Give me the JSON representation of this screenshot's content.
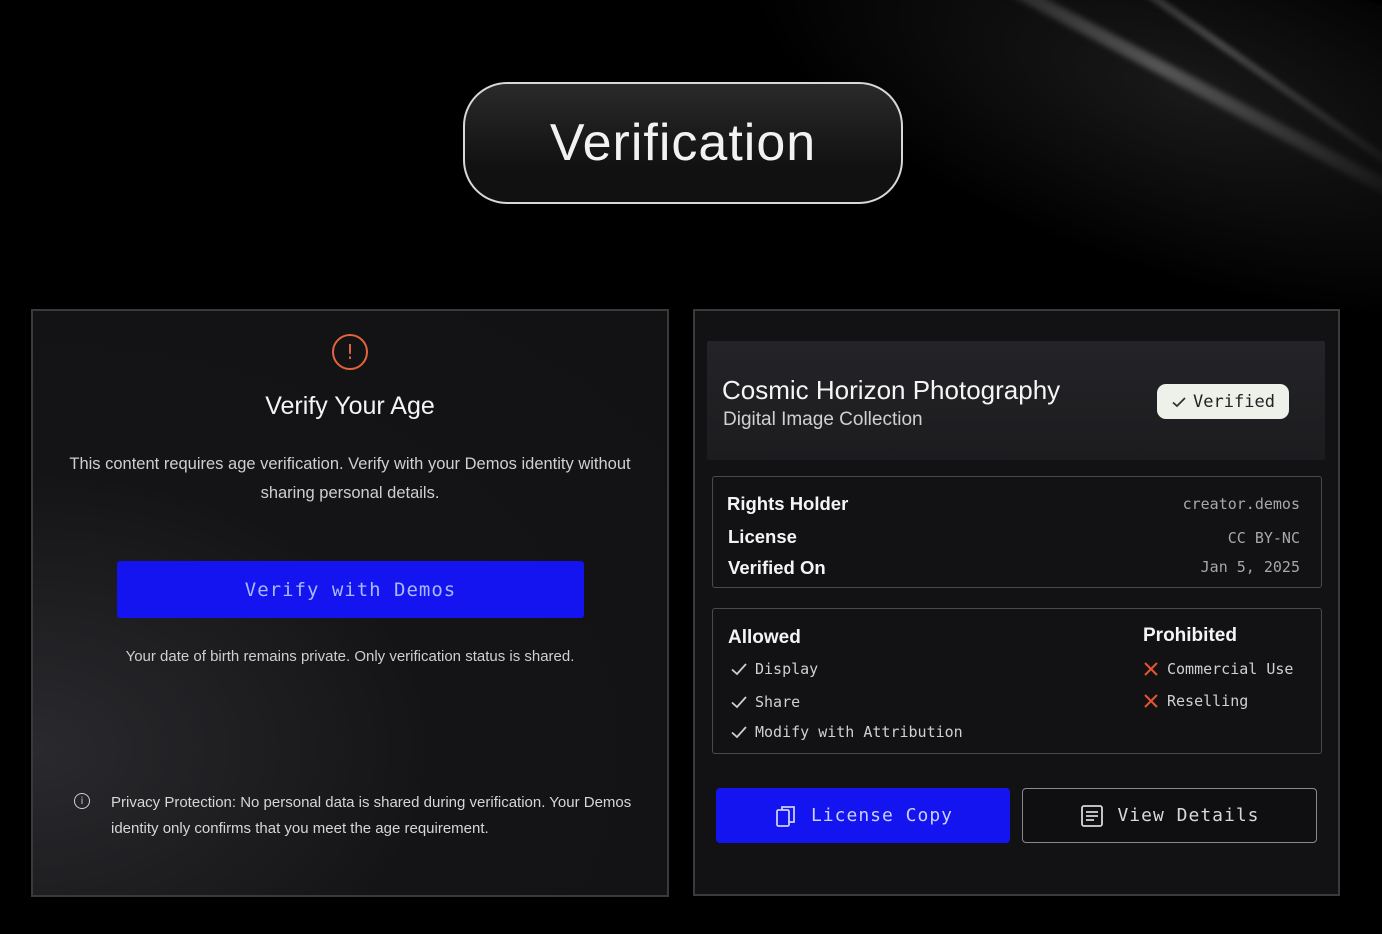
{
  "header": {
    "title": "Verification"
  },
  "age_panel": {
    "icon": "warning-icon",
    "title": "Verify Your Age",
    "description": "This content requires age verification. Verify with your Demos identity without sharing personal details.",
    "button_label": "Verify with Demos",
    "privacy_note": "Your date of birth remains private. Only verification status is shared.",
    "protection_text": "Privacy Protection: No personal data is shared during verification. Your Demos identity only confirms that you meet the age requirement.",
    "accent_color": "#1414f0",
    "warning_color": "#e4643a"
  },
  "asset_panel": {
    "title": "Cosmic Horizon Photography",
    "subtitle": "Digital Image Collection",
    "badge": "Verified",
    "rights_holder_label": "Rights Holder",
    "rights_holder_value": "creator.demos",
    "license_label": "License",
    "license_value": "CC BY-NC",
    "verified_on_label": "Verified On",
    "verified_on_value": "Jan 5, 2025",
    "allowed_heading": "Allowed",
    "allowed": [
      "Display",
      "Share",
      "Modify with Attribution"
    ],
    "prohibited_heading": "Prohibited",
    "prohibited": [
      "Commercial Use",
      "Reselling"
    ],
    "license_button": "License Copy",
    "details_button": "View Details",
    "prohibited_color": "#e8542e"
  }
}
